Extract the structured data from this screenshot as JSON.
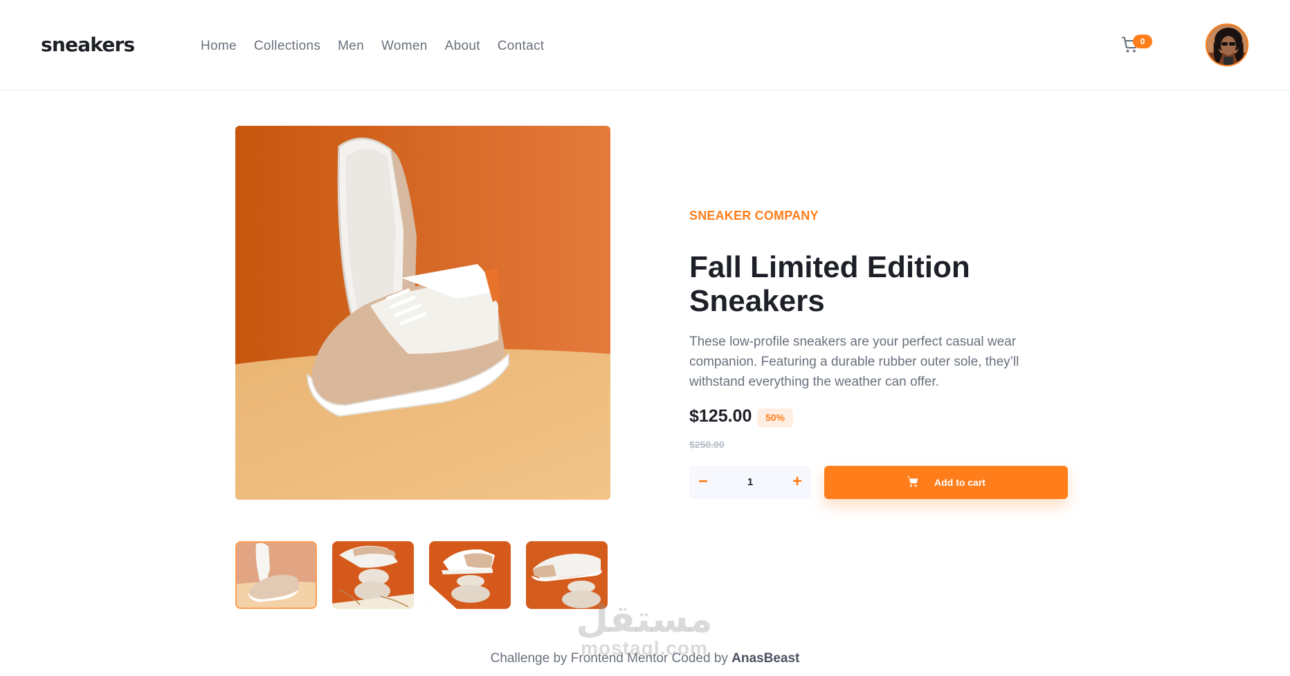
{
  "header": {
    "logo": "sneakers",
    "nav": [
      "Home",
      "Collections",
      "Men",
      "Women",
      "About",
      "Contact"
    ],
    "cart_count": "0"
  },
  "product": {
    "company": "SNEAKER COMPANY",
    "title": "Fall Limited Edition Sneakers",
    "description": "These low-profile sneakers are your perfect casual wear companion. Featuring a durable rubber outer sole, they’ll withstand everything the weather can offer.",
    "price": "$125.00",
    "discount": "50%",
    "old_price": "$250.00",
    "quantity": "1",
    "minus_label": "−",
    "plus_label": "+",
    "add_to_cart": "Add to cart"
  },
  "footer": {
    "prefix": "Challenge by Frontend Mentor Coded by ",
    "author": "AnasBeast"
  },
  "watermark": {
    "arabic": "مستقل",
    "latin": "mostaql.com"
  },
  "colors": {
    "accent": "#ff7e1b",
    "accent_pale": "#ffeee2",
    "text_dark": "#1d2026",
    "text_gray": "#69707d"
  }
}
